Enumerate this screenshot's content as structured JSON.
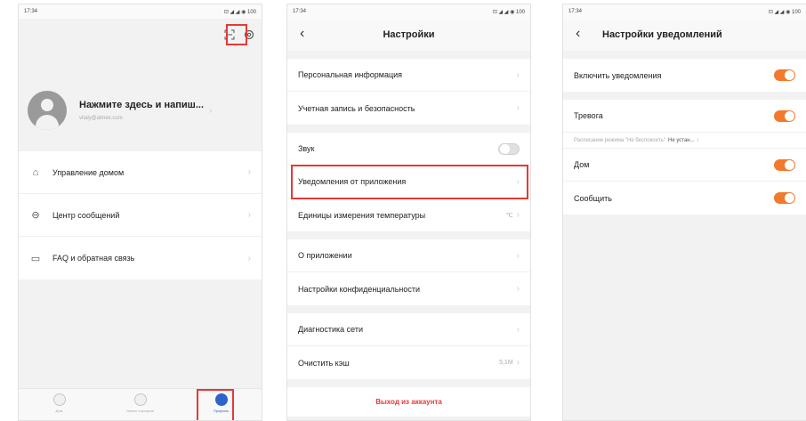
{
  "screen1": {
    "status": {
      "time": "17:34",
      "icons": "⊡ ◢ ◢ ◉ 100"
    },
    "top_icons": [
      "scan-icon",
      "gear-icon"
    ],
    "profile": {
      "name": "Нажмите здесь и напиш...",
      "email": "vitaly@almex.com"
    },
    "menu": [
      {
        "label": "Управление домом",
        "icon": "home-icon"
      },
      {
        "label": "Центр сообщений",
        "icon": "message-icon"
      },
      {
        "label": "FAQ и обратная связь",
        "icon": "faq-icon"
      }
    ],
    "tabs": [
      {
        "label": "Дом",
        "icon": "home-tab-icon"
      },
      {
        "label": "Умные сценарии",
        "icon": "scenes-tab-icon"
      },
      {
        "label": "Профиль",
        "icon": "profile-tab-icon"
      }
    ]
  },
  "screen2": {
    "status": {
      "time": "17:34",
      "icons": "⊡ ◢ ◢ ◉ 100"
    },
    "title": "Настройки",
    "groups": [
      [
        {
          "label": "Персональная информация"
        },
        {
          "label": "Учетная запись и безопасность"
        }
      ],
      [
        {
          "label": "Звук",
          "toggle": "off"
        },
        {
          "label": "Уведомления от приложения"
        },
        {
          "label": "Единицы измерения температуры",
          "value": "℃"
        }
      ],
      [
        {
          "label": "О приложении"
        },
        {
          "label": "Настройки конфиденциальности"
        }
      ],
      [
        {
          "label": "Диагностика сети"
        },
        {
          "label": "Очистить кэш",
          "value": "5,1M"
        }
      ]
    ],
    "logout_label": "Выход из аккаунта"
  },
  "screen3": {
    "status": {
      "time": "17:34",
      "icons": "⊡ ◢ ◢ ◉ 100"
    },
    "title": "Настройки уведомлений",
    "enable_label": "Включить уведомления",
    "alarm_label": "Тревога",
    "dnd_label": "Расписание режима \"Не беспокоить\"",
    "dnd_value": "Не устан...",
    "home_label": "Дом",
    "message_label": "Сообщить",
    "toggles": {
      "enable": "on",
      "alarm": "on",
      "home": "on",
      "message": "on"
    }
  },
  "chevron": "›",
  "back_glyph": "‹",
  "highlight_color": "#e53935",
  "accent_color": "#f27a2c"
}
